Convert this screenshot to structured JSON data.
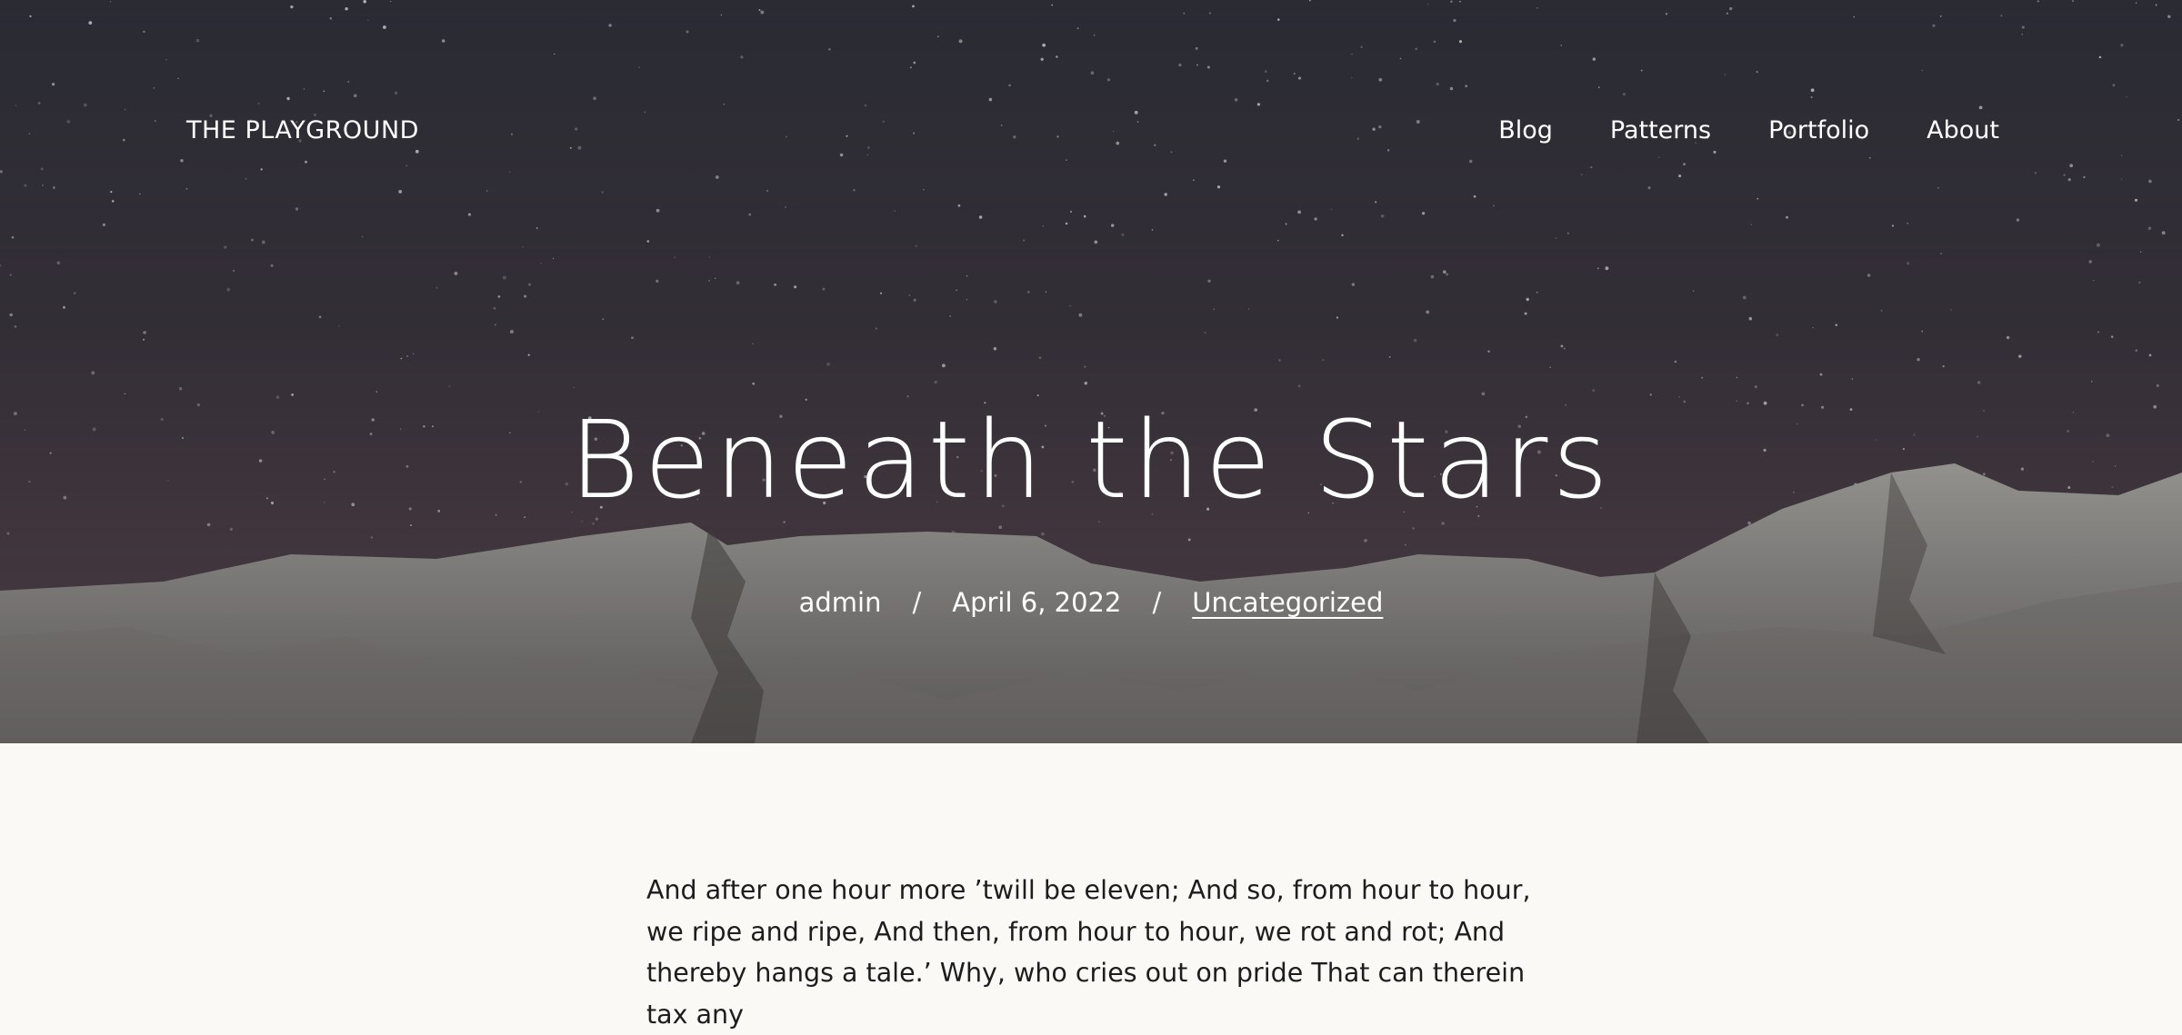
{
  "site": {
    "title": "THE PLAYGROUND"
  },
  "nav": {
    "items": [
      "Blog",
      "Patterns",
      "Portfolio",
      "About"
    ]
  },
  "post": {
    "title": "Beneath the Stars",
    "author": "admin",
    "separator": "/",
    "date": "April 6, 2022",
    "category": "Uncategorized",
    "body": "And after one hour more ’twill be eleven; And so, from hour to hour, we ripe and ripe, And then, from hour to hour, we rot and rot; And thereby hangs a tale.’ Why, who cries out on pride That can therein tax any"
  },
  "colors": {
    "hero_overlay": "#3b3640",
    "page_background": "#faf9f5",
    "text": "#1d1d1d",
    "hero_text": "#ffffff"
  }
}
